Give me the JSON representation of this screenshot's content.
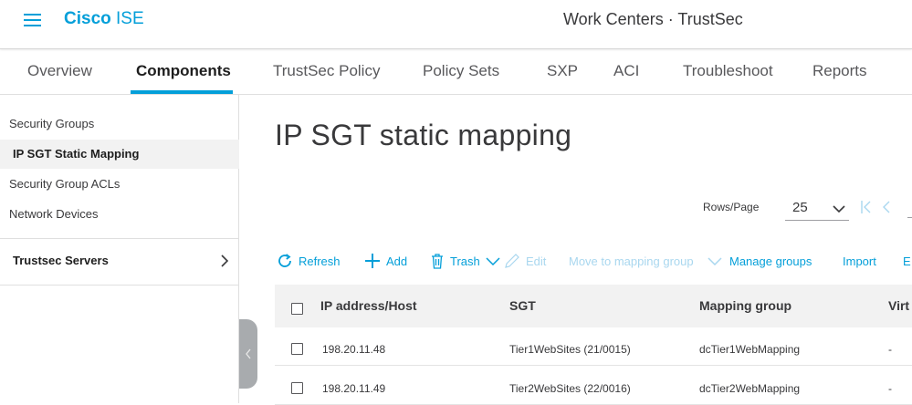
{
  "header": {
    "brand_bold": "Cisco",
    "brand_rest": " ISE",
    "context": "Work Centers · TrustSec"
  },
  "tabs": [
    {
      "label": "Overview",
      "active": false
    },
    {
      "label": "Components",
      "active": true
    },
    {
      "label": "TrustSec Policy",
      "active": false
    },
    {
      "label": "Policy Sets",
      "active": false
    },
    {
      "label": "SXP",
      "active": false
    },
    {
      "label": "ACI",
      "active": false
    },
    {
      "label": "Troubleshoot",
      "active": false
    },
    {
      "label": "Reports",
      "active": false
    }
  ],
  "sidebar": {
    "items": [
      {
        "label": "Security Groups"
      },
      {
        "label": "IP SGT Static Mapping",
        "active": true
      },
      {
        "label": "Security Group ACLs"
      },
      {
        "label": "Network Devices"
      }
    ],
    "section": {
      "label": "Trustsec Servers"
    }
  },
  "main": {
    "title": "IP SGT static mapping",
    "rows_per_page_label": "Rows/Page",
    "rows_per_page_value": "25"
  },
  "toolbar": {
    "refresh": "Refresh",
    "add": "Add",
    "trash": "Trash",
    "edit": "Edit",
    "move": "Move to mapping group",
    "manage": "Manage groups",
    "import": "Import",
    "export": "E"
  },
  "table": {
    "columns": [
      "IP address/Host",
      "SGT",
      "Mapping group",
      "Virt"
    ],
    "rows": [
      {
        "ip": "198.20.11.48",
        "sgt": "Tier1WebSites (21/0015)",
        "group": "dcTier1WebMapping",
        "virt": "-"
      },
      {
        "ip": "198.20.11.49",
        "sgt": "Tier2WebSites (22/0016)",
        "group": "dcTier2WebMapping",
        "virt": "-"
      }
    ]
  },
  "colors": {
    "accent": "#049fd9",
    "disabled": "#a9d7ef",
    "text": "#39393b",
    "header_bg": "#f2f2f2"
  },
  "icons": [
    "menu-icon",
    "refresh-icon",
    "plus-icon",
    "trash-icon",
    "chevron-down-icon",
    "pencil-icon",
    "chevron-right-icon",
    "chevron-left-icon",
    "first-page-icon"
  ]
}
